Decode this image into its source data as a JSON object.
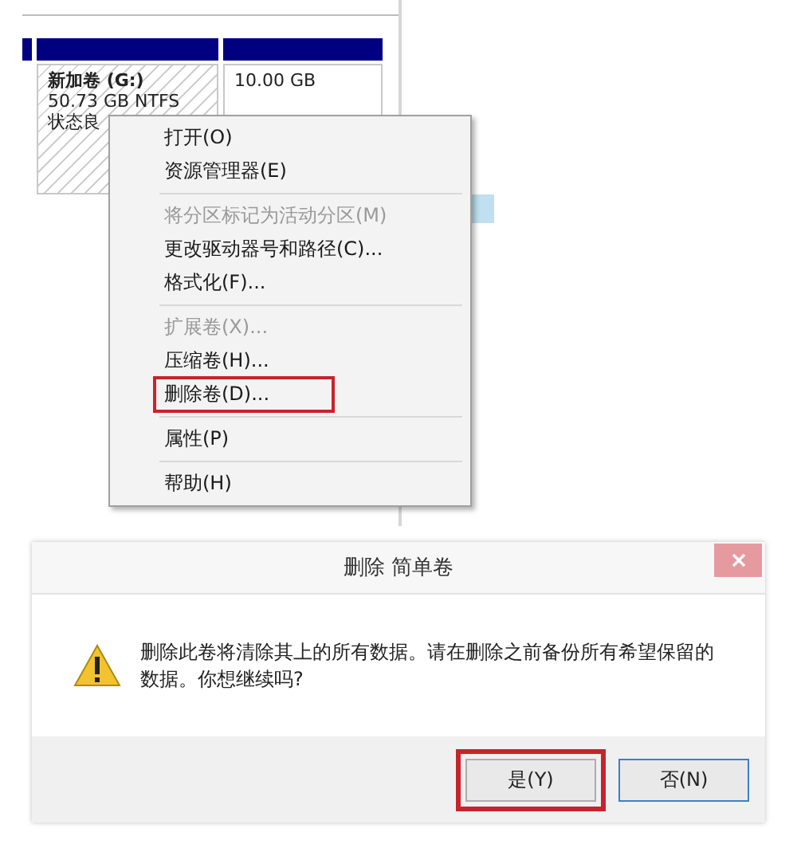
{
  "disk": {
    "volumes": [
      {
        "name": "新加卷 (G:)",
        "size": "50.73 GB NTFS",
        "status": "状态良",
        "hatched": true
      },
      {
        "size": "10.00 GB",
        "hatched": false
      }
    ]
  },
  "context_menu": {
    "sections": [
      {
        "items": [
          {
            "label": "打开(O)",
            "disabled": false,
            "highlighted": false
          },
          {
            "label": "资源管理器(E)",
            "disabled": false,
            "highlighted": false
          }
        ]
      },
      {
        "items": [
          {
            "label": "将分区标记为活动分区(M)",
            "disabled": true,
            "highlighted": false
          },
          {
            "label": "更改驱动器号和路径(C)...",
            "disabled": false,
            "highlighted": false
          },
          {
            "label": "格式化(F)...",
            "disabled": false,
            "highlighted": false
          }
        ]
      },
      {
        "items": [
          {
            "label": "扩展卷(X)...",
            "disabled": true,
            "highlighted": false
          },
          {
            "label": "压缩卷(H)...",
            "disabled": false,
            "highlighted": false
          },
          {
            "label": "删除卷(D)...",
            "disabled": false,
            "highlighted": true
          }
        ]
      },
      {
        "items": [
          {
            "label": "属性(P)",
            "disabled": false,
            "highlighted": false
          }
        ]
      },
      {
        "items": [
          {
            "label": "帮助(H)",
            "disabled": false,
            "highlighted": false
          }
        ]
      }
    ]
  },
  "dialog": {
    "title": "删除 简单卷",
    "message": "删除此卷将清除其上的所有数据。请在删除之前备份所有希望保留的数据。你想继续吗?",
    "buttons": [
      {
        "label": "是(Y)",
        "highlighted": true,
        "focused": false
      },
      {
        "label": "否(N)",
        "highlighted": false,
        "focused": true
      }
    ]
  }
}
